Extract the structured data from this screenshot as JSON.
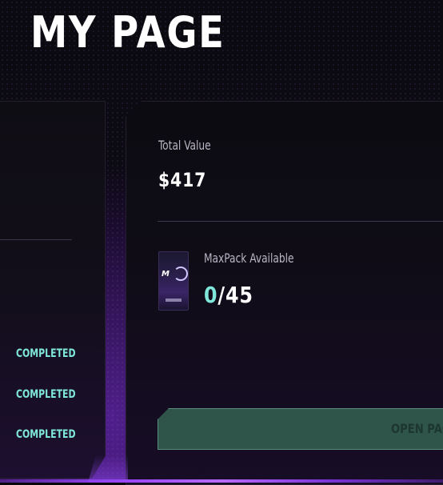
{
  "page": {
    "title": "MY PAGE"
  },
  "summary": {
    "total_value_label": "Total Value",
    "total_value": "$417"
  },
  "maxpack": {
    "label": "MaxPack Available",
    "available": "0",
    "separator": "/",
    "total": "45",
    "icon": "maxpack-card-icon",
    "open_button_label": "OPEN PACK"
  },
  "missions": {
    "statuses": [
      "COMPLETED",
      "COMPLETED",
      "COMPLETED"
    ]
  },
  "colors": {
    "accent_teal": "#7fe8da",
    "accent_purple": "#9b49ff",
    "button_bg": "#2f5449",
    "background": "#08070b"
  }
}
